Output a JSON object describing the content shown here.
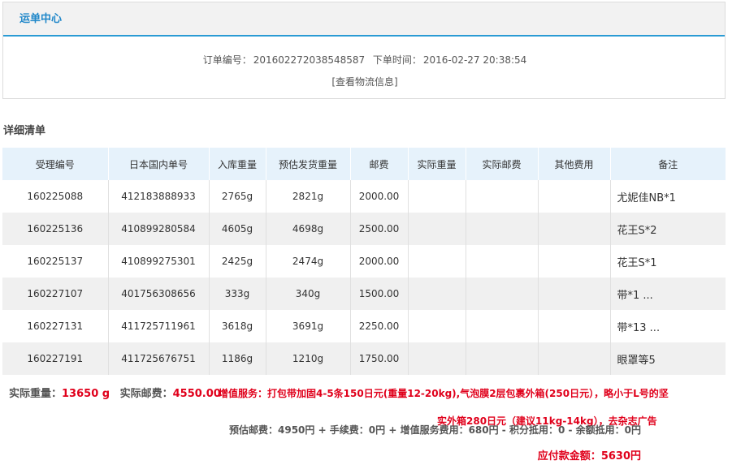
{
  "panel": {
    "title": "运单中心",
    "order_label": "订单编号：",
    "order_number": "201602272038548587",
    "time_label": "下单时间：",
    "order_time": "2016-02-27 20:38:54",
    "logistics_link": "[查看物流信息]"
  },
  "detail": {
    "title": "详细清单",
    "columns": [
      "受理编号",
      "日本国内单号",
      "入库重量",
      "预估发货重量",
      "邮费",
      "实际重量",
      "实际邮费",
      "其他费用",
      "备注"
    ],
    "rows": [
      [
        "160225088",
        "412183888933",
        "2765g",
        "2821g",
        "2000.00",
        "",
        "",
        "",
        "尤妮佳NB*1"
      ],
      [
        "160225136",
        "410899280584",
        "4605g",
        "4698g",
        "2500.00",
        "",
        "",
        "",
        "花王S*2"
      ],
      [
        "160225137",
        "410899275301",
        "2425g",
        "2474g",
        "2000.00",
        "",
        "",
        "",
        "花王S*1"
      ],
      [
        "160227107",
        "401756308656",
        "333g",
        "340g",
        "1500.00",
        "",
        "",
        "",
        "带*1 ..."
      ],
      [
        "160227131",
        "411725711961",
        "3618g",
        "3691g",
        "2250.00",
        "",
        "",
        "",
        "带*13 ..."
      ],
      [
        "160227191",
        "411725676751",
        "1186g",
        "1210g",
        "1750.00",
        "",
        "",
        "",
        "眼罩等5"
      ]
    ]
  },
  "summary": {
    "actual_weight_label": "实际重量：",
    "actual_weight": "13650 g",
    "actual_postage_label": "实际邮费：",
    "actual_postage": "4550.00",
    "service_line1": "增值服务：打包带加固4-5条150日元(重量12-20kg),气泡膜2层包裹外箱(250日元），略小于L号的坚",
    "service_line2": "实外箱280日元（建议11kg-14kg），去杂志广告",
    "fees_line": "预估邮费：4950円 + 手续费：0円 + 增值服务费用：680円 - 积分抵用：0 - 余额抵用：0円",
    "total_label": "应付款金额：",
    "total": "5630円"
  }
}
